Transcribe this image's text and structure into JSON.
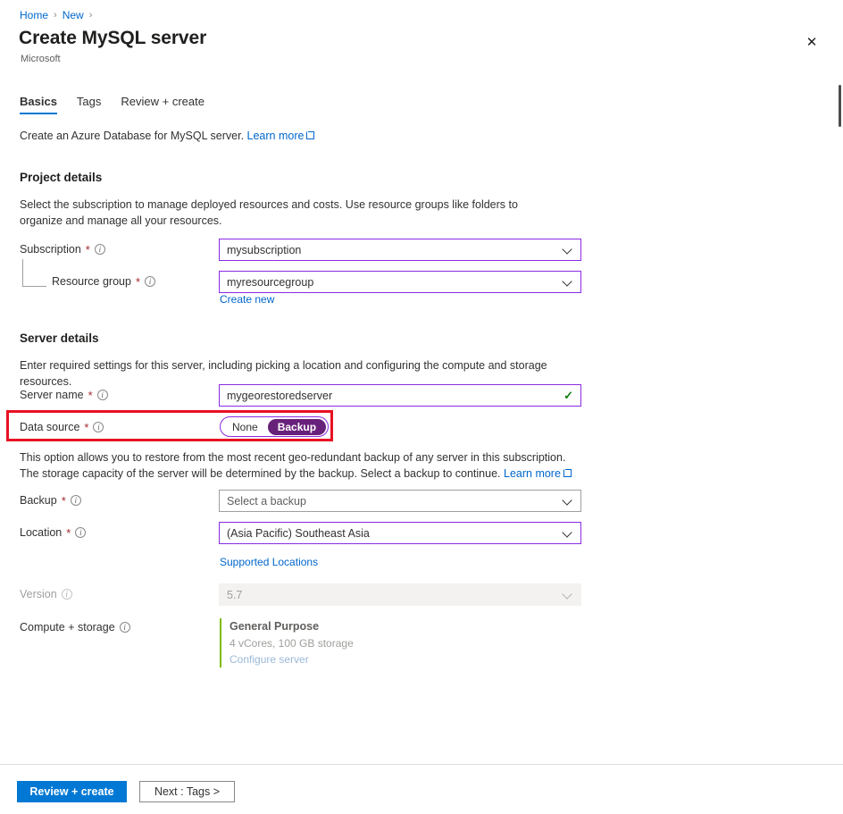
{
  "breadcrumb": {
    "home": "Home",
    "new": "New",
    "sep": "›"
  },
  "header": {
    "title": "Create MySQL server",
    "publisher": "Microsoft",
    "close_icon": "✕"
  },
  "tabs": [
    {
      "label": "Basics"
    },
    {
      "label": "Tags"
    },
    {
      "label": "Review + create"
    }
  ],
  "intro": {
    "text": "Create an Azure Database for MySQL server.",
    "link": "Learn more"
  },
  "project_details": {
    "heading": "Project details",
    "description": "Select the subscription to manage deployed resources and costs. Use resource groups like folders to organize and manage all your resources.",
    "subscription": {
      "label": "Subscription",
      "required": "*",
      "value": "mysubscription"
    },
    "resource_group": {
      "label": "Resource group",
      "required": "*",
      "value": "myresourcegroup",
      "create_new": "Create new"
    }
  },
  "server_details": {
    "heading": "Server details",
    "description": "Enter required settings for this server, including picking a location and configuring the compute and storage resources.",
    "server_name": {
      "label": "Server name",
      "required": "*",
      "value": "mygeorestoredserver",
      "valid_icon": "✓"
    },
    "data_source": {
      "label": "Data source",
      "required": "*",
      "options": [
        "None",
        "Backup"
      ],
      "selected": "Backup"
    },
    "data_source_helper": {
      "text": "This option allows you to restore from the most recent geo-redundant backup of any server in this subscription. The storage capacity of the server will be determined by the backup. Select a backup to continue.",
      "link": "Learn more"
    },
    "backup": {
      "label": "Backup",
      "required": "*",
      "placeholder": "Select a backup"
    },
    "location": {
      "label": "Location",
      "required": "*",
      "value": "(Asia Pacific) Southeast Asia",
      "supported_link": "Supported Locations"
    },
    "version": {
      "label": "Version",
      "value": "5.7"
    },
    "compute_storage": {
      "label": "Compute + storage",
      "tier": "General Purpose",
      "specs": "4 vCores, 100 GB storage",
      "configure_link": "Configure server"
    }
  },
  "footer": {
    "review_create": "Review + create",
    "next_tags": "Next : Tags >"
  },
  "colors": {
    "accent_blue": "#0078d4",
    "link_blue": "#0066cc",
    "focus_purple": "#8a2be2",
    "toggle_purple": "#68217a",
    "required_red": "#a4262c",
    "annotation_red": "#e81123",
    "valid_green": "#107c10",
    "card_green": "#7fba00"
  }
}
